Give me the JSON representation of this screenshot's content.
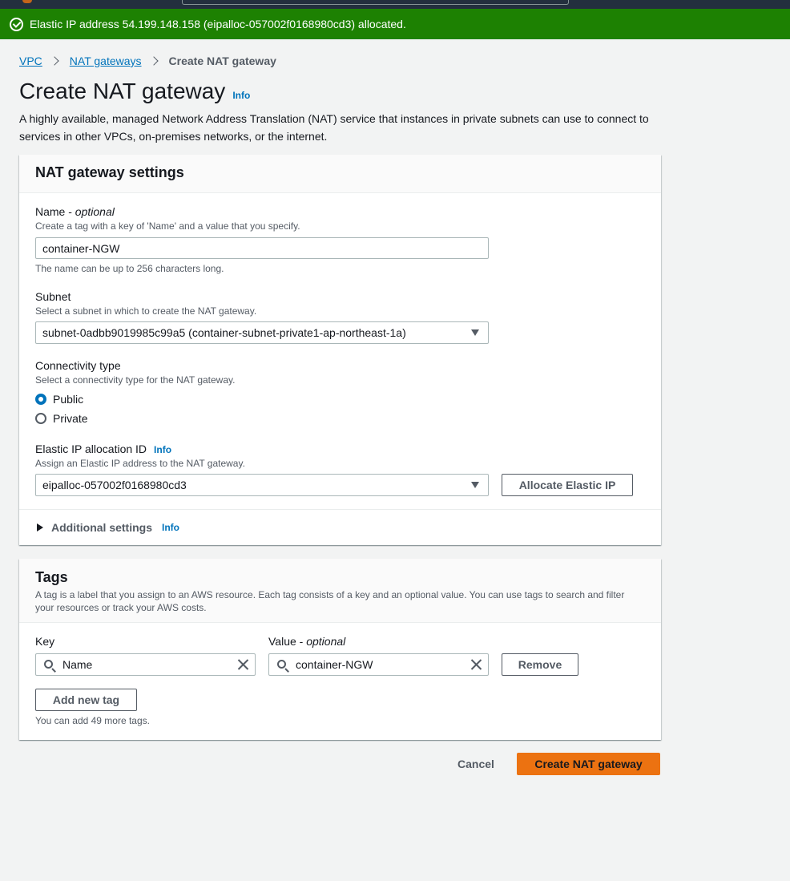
{
  "flash": {
    "message": "Elastic IP address 54.199.148.158 (eipalloc-057002f0168980cd3) allocated."
  },
  "breadcrumb": {
    "items": [
      "VPC",
      "NAT gateways"
    ],
    "current": "Create NAT gateway"
  },
  "page": {
    "title": "Create NAT gateway",
    "info_label": "Info",
    "description": "A highly available, managed Network Address Translation (NAT) service that instances in private subnets can use to connect to services in other VPCs, on-premises networks, or the internet."
  },
  "settings": {
    "title": "NAT gateway settings",
    "name_label": "Name - ",
    "name_optional": "optional",
    "name_hint": "Create a tag with a key of 'Name' and a value that you specify.",
    "name_value": "container-NGW",
    "name_constraint": "The name can be up to 256 characters long.",
    "subnet_label": "Subnet",
    "subnet_hint": "Select a subnet in which to create the NAT gateway.",
    "subnet_value": "subnet-0adbb9019985c99a5 (container-subnet-private1-ap-northeast-1a)",
    "connectivity_label": "Connectivity type",
    "connectivity_hint": "Select a connectivity type for the NAT gateway.",
    "connectivity_options": [
      {
        "label": "Public",
        "selected": true
      },
      {
        "label": "Private",
        "selected": false
      }
    ],
    "eip_label": "Elastic IP allocation ID",
    "eip_info": "Info",
    "eip_hint": "Assign an Elastic IP address to the NAT gateway.",
    "eip_value": "eipalloc-057002f0168980cd3",
    "allocate_button": "Allocate Elastic IP",
    "additional_label": "Additional settings",
    "additional_info": "Info"
  },
  "tags": {
    "title": "Tags",
    "description": "A tag is a label that you assign to an AWS resource. Each tag consists of a key and an optional value. You can use tags to search and filter your resources or track your AWS costs.",
    "key_label": "Key",
    "value_label": "Value - ",
    "value_optional": "optional",
    "rows": [
      {
        "key": "Name",
        "value": "container-NGW"
      }
    ],
    "remove_button": "Remove",
    "add_button": "Add new tag",
    "limit_text": "You can add 49 more tags."
  },
  "footer": {
    "cancel": "Cancel",
    "create": "Create NAT gateway"
  },
  "colors": {
    "accent": "#0073bb",
    "primary_button": "#ec7211",
    "success": "#1d8102"
  }
}
